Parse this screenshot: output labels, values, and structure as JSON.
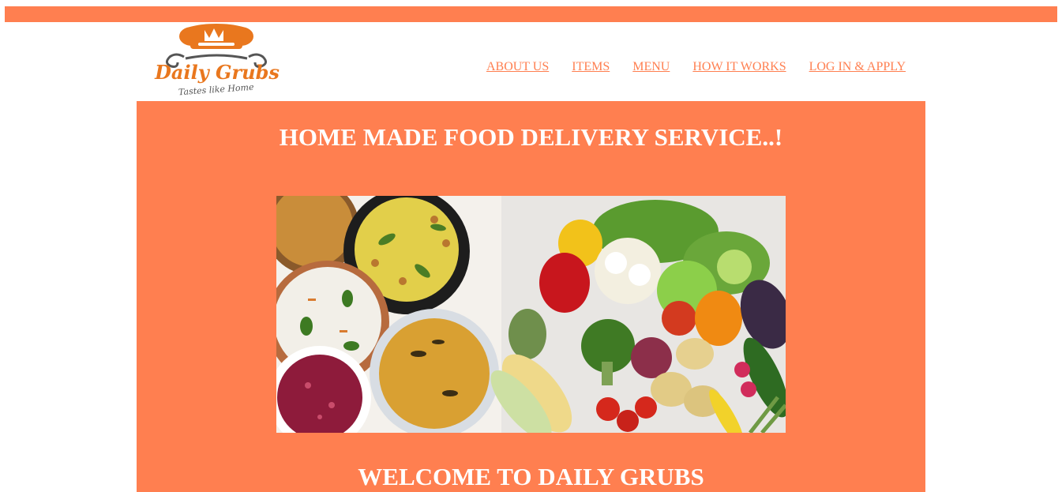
{
  "colors": {
    "brand": "#FF7F50",
    "text_on_brand": "#ffffff",
    "logo_dark": "#444444"
  },
  "logo": {
    "brand_name": "Daily Grubs",
    "tagline": "Tastes like Home",
    "icon": "chef-hat-icon"
  },
  "nav": {
    "items": [
      {
        "label": "ABOUT US"
      },
      {
        "label": "ITEMS"
      },
      {
        "label": "MENU"
      },
      {
        "label": "HOW IT WORKS"
      },
      {
        "label": "LOG IN & APPLY"
      }
    ]
  },
  "hero": {
    "title": "HOME MADE FOOD DELIVERY SERVICE..!",
    "image_alt": "food-and-vegetables-photo",
    "welcome": "WELCOME TO DAILY GRUBS"
  }
}
